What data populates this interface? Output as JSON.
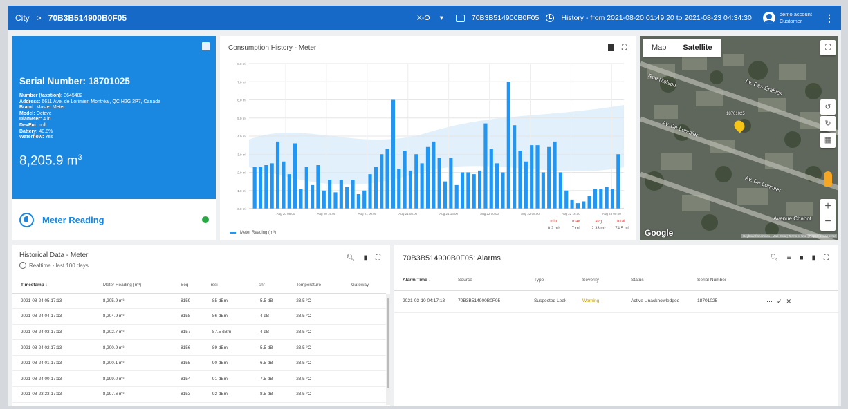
{
  "header": {
    "breadcrumb_root": "City",
    "breadcrumb_sep": ">",
    "device": "70B3B514900B0F05",
    "selector": "X-O",
    "device_badge": "70B3B514900B0F05",
    "history": "History - from 2021-08-20 01:49:20 to 2021-08-23 04:34:30",
    "user_name": "demo account",
    "user_role": "Customer"
  },
  "meter": {
    "serial": "Serial Number: 18701025",
    "details": [
      {
        "label": "Number (taxation):",
        "value": "3645482"
      },
      {
        "label": "Address:",
        "value": "6611 Ave. de Lorimier, Montréal, QC H2G 2P7, Canada"
      },
      {
        "label": "Brand:",
        "value": "Master Meter"
      },
      {
        "label": "Model:",
        "value": "Octave"
      },
      {
        "label": "Diameter:",
        "value": "4 in"
      },
      {
        "label": "DevEui:",
        "value": "null"
      },
      {
        "label": "Battery:",
        "value": "40.8%"
      },
      {
        "label": "Waterflow:",
        "value": "Yes"
      }
    ],
    "reading_value": "8,205.9 m",
    "reading_unit_sup": "3",
    "footer_label": "Meter Reading",
    "status_color": "#28a745"
  },
  "chart": {
    "title": "Consumption History - Meter",
    "legend": "Meter Reading (m³)",
    "stats_labels": [
      "min",
      "max",
      "avg",
      "total"
    ],
    "stats_values": [
      "0.2 m³",
      "7 m³",
      "2.33 m³",
      "174.5 m³"
    ],
    "accent": "#2196f3"
  },
  "chart_data": {
    "type": "bar",
    "yticks": [
      "0.0 m³",
      "1.0 m³",
      "2.0 m³",
      "3.0 m³",
      "4.0 m³",
      "5.0 m³",
      "6.0 m³",
      "7.0 m³",
      "8.0 m³"
    ],
    "xticks": [
      "Aug 20 08:00",
      "Aug 20 16:00",
      "Aug 21 00:00",
      "Aug 21 08:00",
      "Aug 21 16:00",
      "Aug 22 00:00",
      "Aug 22 08:00",
      "Aug 22 16:00",
      "Aug 23 00:00"
    ],
    "ylim": [
      0,
      8
    ],
    "ylabel": "",
    "xlabel": "",
    "series": [
      {
        "name": "Meter Reading (m³)",
        "values": [
          2.3,
          2.3,
          2.4,
          2.5,
          3.7,
          2.6,
          1.9,
          3.6,
          1.1,
          2.3,
          1.3,
          2.4,
          1.0,
          1.6,
          0.9,
          1.6,
          1.2,
          1.6,
          0.8,
          1.0,
          1.9,
          2.3,
          3.0,
          3.3,
          6.0,
          2.2,
          3.2,
          2.1,
          3.0,
          2.5,
          3.4,
          3.7,
          2.8,
          1.5,
          2.8,
          1.3,
          2.0,
          2.0,
          1.9,
          2.1,
          4.7,
          3.3,
          2.5,
          2.0,
          7.0,
          4.6,
          3.2,
          2.6,
          3.5,
          3.5,
          2.0,
          3.4,
          3.7,
          2.0,
          1.0,
          0.5,
          0.3,
          0.4,
          0.7,
          1.1,
          1.1,
          1.2,
          1.1,
          3.0
        ]
      }
    ]
  },
  "map": {
    "tab_map": "Map",
    "tab_satellite": "Satellite",
    "streets": [
      "Av. De Lorimier",
      "Av. Des Érables",
      "Rue Molson",
      "Avenue Chabot",
      "Av. De Lorimier"
    ],
    "pin_label": "18701025",
    "google": "Google",
    "copyright": "Keyboard shortcuts | Map Data | Terms of Use | Report a map error"
  },
  "history": {
    "title": "Historical Data - Meter",
    "subtitle": "Realtime - last 100 days",
    "columns": [
      "Timestamp",
      "Meter Reading (m³)",
      "Seq",
      "rssi",
      "snr",
      "Temperature",
      "Gateway"
    ],
    "rows": [
      [
        "2021-08-24 05:17:13",
        "8,205.9 m³",
        "8159",
        "-85 dBm",
        "-5.5 dB",
        "23.5 °C",
        ""
      ],
      [
        "2021-08-24 04:17:13",
        "8,204.9 m³",
        "8158",
        "-86 dBm",
        "-4 dB",
        "23.5 °C",
        ""
      ],
      [
        "2021-08-24 03:17:13",
        "8,202.7 m³",
        "8157",
        "-87.5 dBm",
        "-4 dB",
        "23.5 °C",
        ""
      ],
      [
        "2021-08-24 02:17:13",
        "8,200.9 m³",
        "8156",
        "-89 dBm",
        "-5.5 dB",
        "23.5 °C",
        ""
      ],
      [
        "2021-08-24 01:17:13",
        "8,200.1 m³",
        "8155",
        "-90 dBm",
        "-6.5 dB",
        "23.5 °C",
        ""
      ],
      [
        "2021-08-24 00:17:13",
        "8,199.0 m³",
        "8154",
        "-91 dBm",
        "-7.5 dB",
        "23.5 °C",
        ""
      ],
      [
        "2021-08-23 23:17:13",
        "8,197.6 m³",
        "8153",
        "-92 dBm",
        "-8.5 dB",
        "23.5 °C",
        ""
      ]
    ]
  },
  "alarms": {
    "title": "70B3B514900B0F05: Alarms",
    "columns": [
      "Alarm Time",
      "Source",
      "Type",
      "Severity",
      "Status",
      "Serial Number"
    ],
    "rows": [
      {
        "time": "2021-03-10 04:17:13",
        "source": "70B3B514900B0F05",
        "type": "Suspected Leak",
        "severity": "Warning",
        "status": "Active Unacknowledged",
        "serial": "18701025"
      }
    ],
    "warning_color": "#c79a00"
  }
}
